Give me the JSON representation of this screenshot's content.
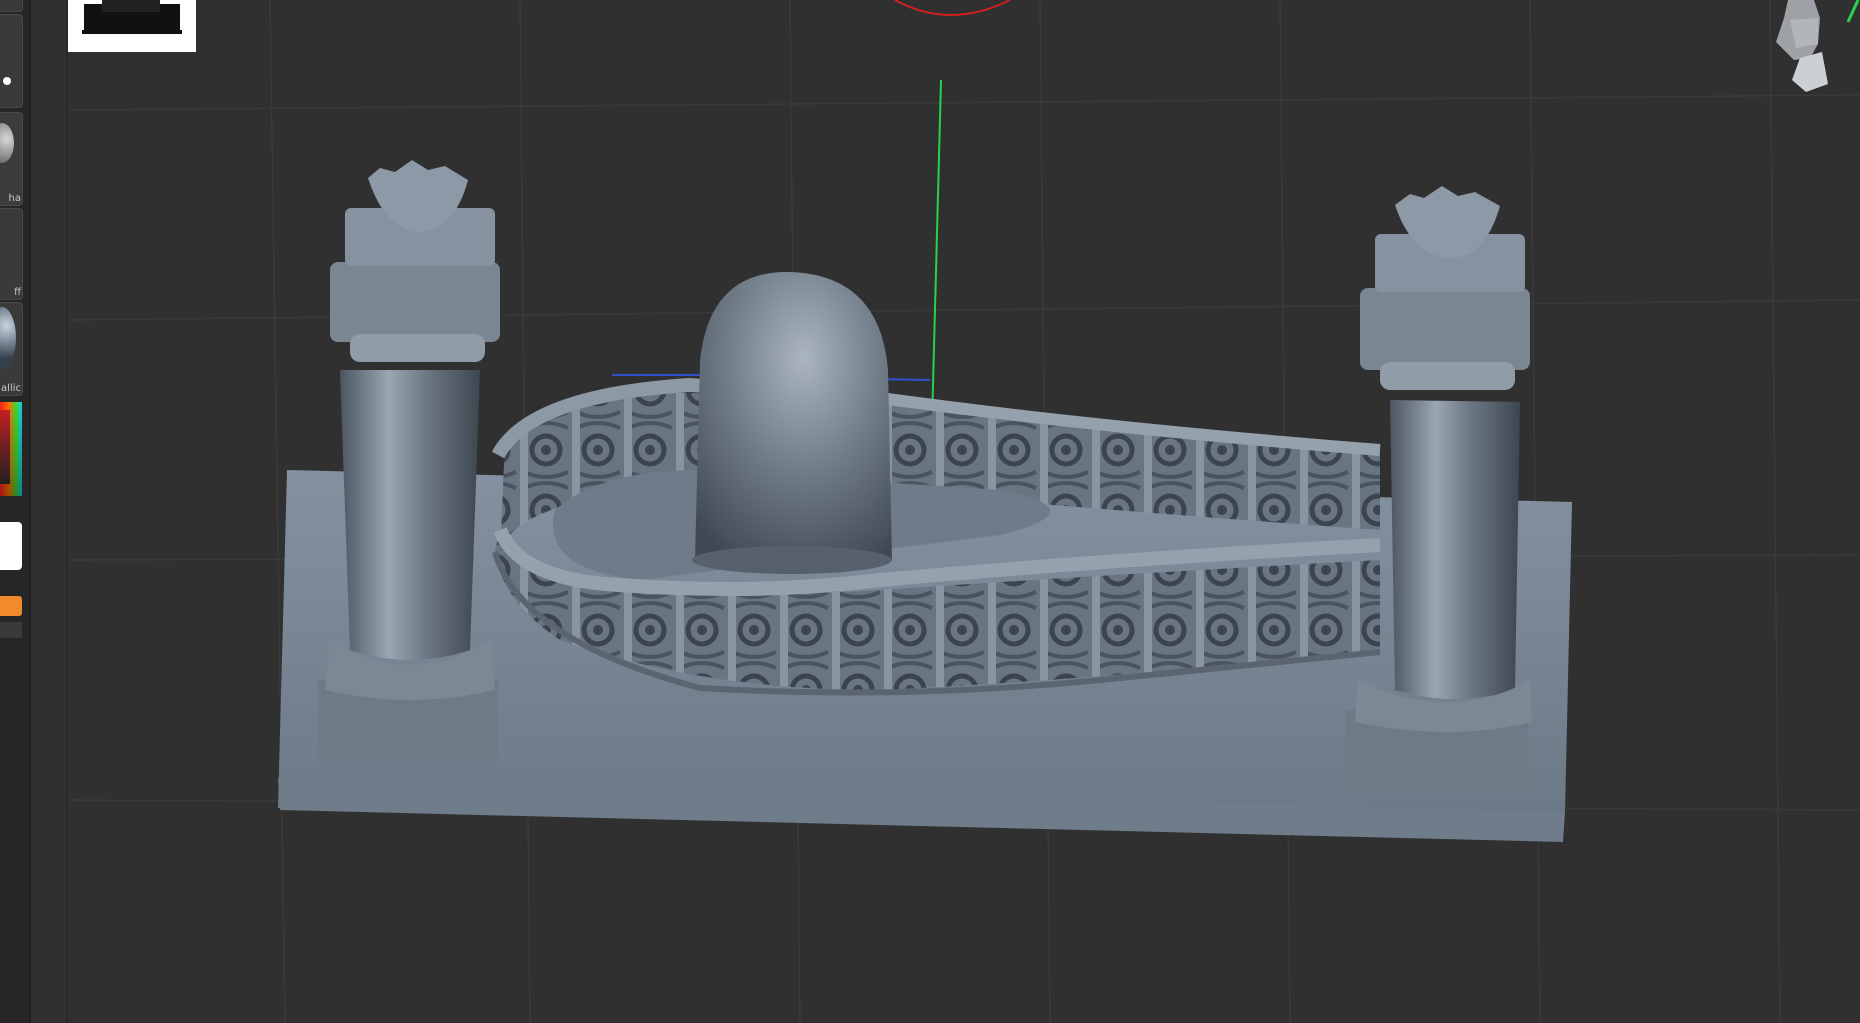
{
  "left_panel": {
    "slots": [
      {
        "name": "brush-slot",
        "label": ""
      },
      {
        "name": "alpha-slot",
        "label": "ha"
      },
      {
        "name": "texture-slot",
        "label": "ff"
      },
      {
        "name": "material-slot",
        "label": "allic"
      },
      {
        "name": "color-picker",
        "label": ""
      },
      {
        "name": "main-color-swatch",
        "label": ""
      },
      {
        "name": "secondary-color-swatch",
        "label": ""
      }
    ]
  },
  "colors": {
    "background": "#303030",
    "grid": "#3a3a3a",
    "model": "#7f8c99",
    "accent_orange": "#f08a2a",
    "axis_green": "#2bd14b",
    "axis_red": "#d02020",
    "axis_blue": "#3050d0"
  },
  "viewport": {
    "model_name": "shiva-lingam-altar",
    "thumbnail_icon": "model-thumbnail-icon",
    "navigation_icon": "head-navigation-icon"
  }
}
